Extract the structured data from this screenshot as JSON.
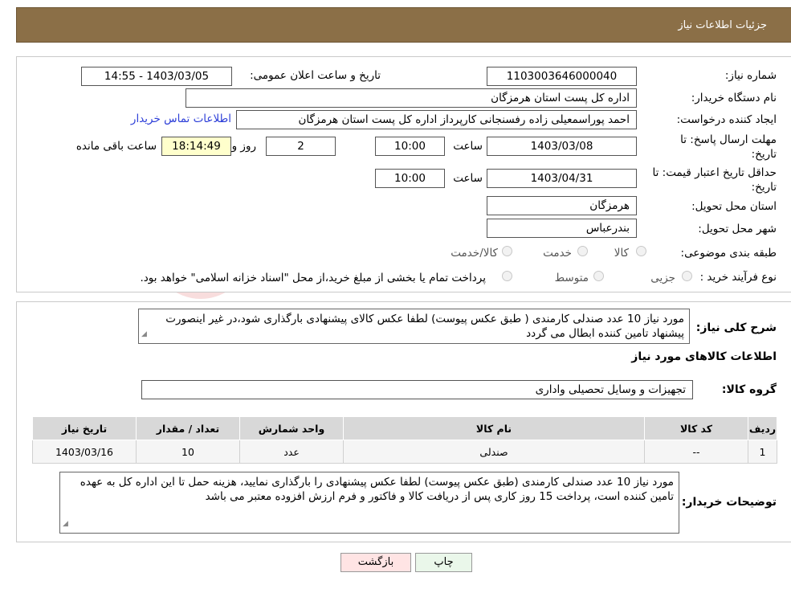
{
  "header": {
    "title": "جزئیات اطلاعات نیاز"
  },
  "form": {
    "need_number_label": "شماره نیاز:",
    "need_number": "1103003646000040",
    "announce_label": "تاریخ و ساعت اعلان عمومی:",
    "announce_value": "1403/03/05 - 14:55",
    "buyer_label": "نام دستگاه خریدار:",
    "buyer_value": "اداره کل پست استان هرمزگان",
    "creator_label": "ایجاد کننده درخواست:",
    "creator_value": "احمد پوراسمعیلی زاده رفسنجانی کارپرداز اداره کل پست استان هرمزگان",
    "contact_link": "اطلاعات تماس خریدار",
    "deadline_label_1": "مهلت ارسال پاسخ: تا",
    "deadline_label_2": "تاریخ:",
    "deadline_date": "1403/03/08",
    "time_label": "ساعت",
    "deadline_time": "10:00",
    "days_value": "2",
    "days_label": "روز و",
    "remaining_time": "18:14:49",
    "remaining_label": "ساعت باقی مانده",
    "validity_label_1": "حداقل تاریخ اعتبار قیمت: تا",
    "validity_label_2": "تاریخ:",
    "validity_date": "1403/04/31",
    "validity_time_label": "ساعت",
    "validity_time": "10:00",
    "province_label": "استان محل تحویل:",
    "province_value": "هرمزگان",
    "city_label": "شهر محل تحویل:",
    "city_value": "بندرعباس",
    "category_label": "طبقه بندی موضوعی:",
    "category_options": [
      "کالا",
      "خدمت",
      "کالا/خدمت"
    ],
    "process_label": "نوع فرآیند خرید :",
    "process_options": [
      "جزیی",
      "متوسط"
    ],
    "process_note": "پرداخت تمام یا بخشی از مبلغ خرید،از محل \"اسناد خزانه اسلامی\" خواهد بود."
  },
  "summary": {
    "label": "شرح کلی نیاز:",
    "text": "مورد نیاز 10 عدد صندلی کارمندی ( طبق عکس پیوست) لطفا عکس کالای پیشنهادی بارگذاری شود،در غیر اینصورت پیشنهاد تامین کننده  ابطال می گردد"
  },
  "goods_section": {
    "title": "اطلاعات کالاهای مورد نیاز",
    "group_label": "گروه کالا:",
    "group_value": "تجهیزات و وسایل تحصیلی واداری"
  },
  "table": {
    "headers": [
      "ردیف",
      "کد کالا",
      "نام کالا",
      "واحد شمارش",
      "تعداد / مقدار",
      "تاریخ نیاز"
    ],
    "rows": [
      [
        "1",
        "--",
        "صندلی",
        "عدد",
        "10",
        "1403/03/16"
      ]
    ]
  },
  "buyer_notes": {
    "label": "توضیحات خریدار:",
    "text": "مورد نیاز 10 عدد صندلی کارمندی (طبق عکس پیوست) لطفا عکس پیشنهادی را بارگذاری نمایید، هزینه حمل تا این اداره کل به عهده تامین کننده است، پرداخت 15 روز کاری پس از دریافت کالا و فاکتور  و فرم ارزش افزوده معتبر می باشد"
  },
  "buttons": {
    "print": "چاپ",
    "back": "بازگشت"
  },
  "colors": {
    "header_bg": "#8b6f47",
    "back_button_bg": "#ffe4e4",
    "print_button_bg": "#eaf7ea",
    "link": "#2c3ed8"
  }
}
